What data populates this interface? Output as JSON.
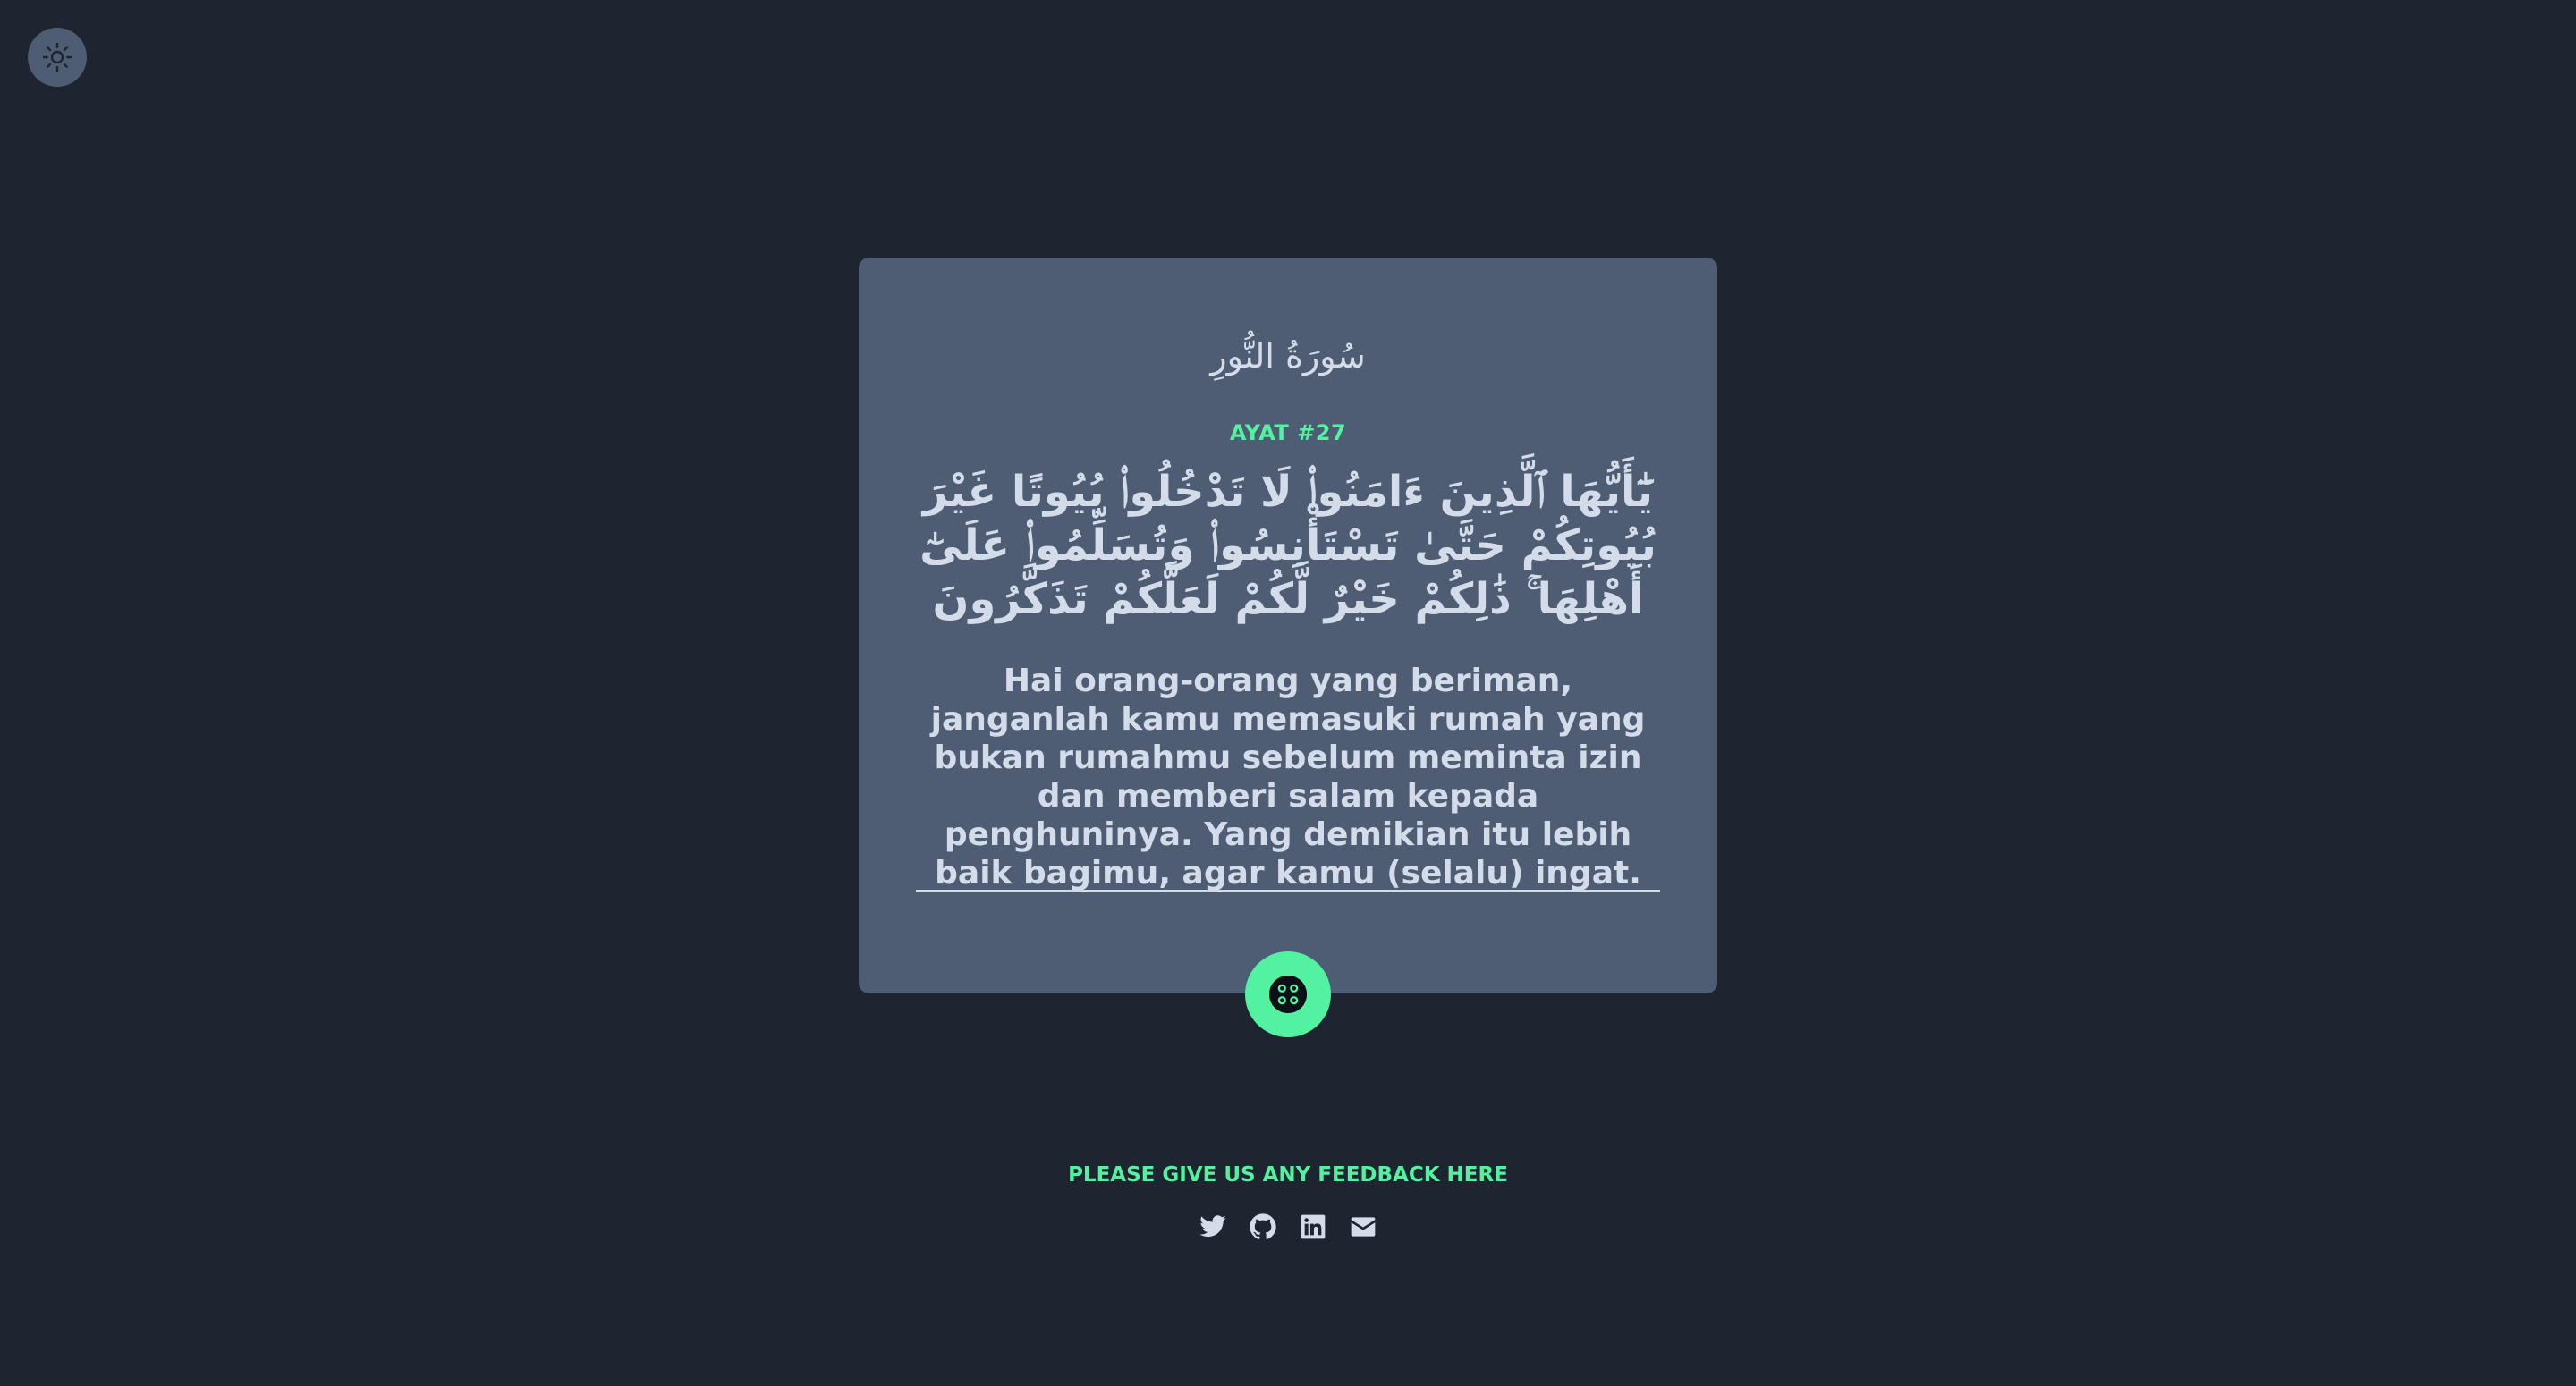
{
  "theme_toggle": {
    "icon": "sun-icon"
  },
  "card": {
    "surah_name": "سُورَةُ النُّورِ",
    "ayat_label": "AYAT #27",
    "arabic_text": "يَٰٓأَيُّهَا ٱلَّذِينَ ءَامَنُوا۟ لَا تَدْخُلُوا۟ بُيُوتًا غَيْرَ بُيُوتِكُمْ حَتَّىٰ تَسْتَأْنِسُوا۟ وَتُسَلِّمُوا۟ عَلَىٰٓ أَهْلِهَا ۚ ذَٰلِكُمْ خَيْرٌ لَّكُمْ لَعَلَّكُمْ تَذَكَّرُونَ",
    "translation": "Hai orang-orang yang beriman, janganlah kamu memasuki rumah yang bukan rumahmu sebelum meminta izin dan memberi salam kepada penghuninya. Yang demikian itu lebih baik bagimu, agar kamu (selalu) ingat."
  },
  "random_button": {
    "icon": "dice-icon"
  },
  "footer": {
    "feedback_text": "PLEASE GIVE US ANY FEEDBACK HERE",
    "socials": [
      "twitter-icon",
      "github-icon",
      "linkedin-icon",
      "email-icon"
    ]
  },
  "colors": {
    "background": "#1f2431",
    "card": "#4e5c74",
    "accent": "#52f2a0",
    "text": "#d4dcea"
  }
}
